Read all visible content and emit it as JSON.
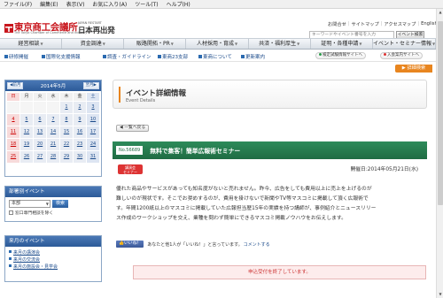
{
  "menubar": [
    "ファイル(F)",
    "編集(E)",
    "表示(V)",
    "お気に入り(A)",
    "ツール(T)",
    "ヘルプ(H)"
  ],
  "header": {
    "logo_main": "東京商工会議所",
    "logo_sub": "The Tokyo Chamber of Commerce and Industry",
    "jr_small": "JAPAN RESTART",
    "jr_main": "日本再出発",
    "links": [
      "お問合せ",
      "サイトマップ",
      "アクセスマップ",
      "English"
    ],
    "search_placeholder": "キーワードやイベント番号を入力",
    "search_button": "イベント検索"
  },
  "nav": [
    "経営相談",
    "資金調達",
    "販路開拓・PR",
    "人材採用・育成",
    "共済・福利厚生",
    "証明・各種申請",
    "イベント・セミナー情報"
  ],
  "subnav": {
    "items": [
      "研修開催",
      "国際化支援情報",
      "調査・ガイドライン",
      "東商23支部",
      "東商について",
      "更新案内"
    ],
    "pills": [
      "検定試験情報サイトへ",
      "入会案内サイトへ"
    ]
  },
  "detail_tab": "詳細検索",
  "calendar": {
    "prev": "◀前月",
    "title": "2014年5月",
    "next": "翌月▶",
    "dow": [
      "日",
      "月",
      "火",
      "水",
      "木",
      "金",
      "土"
    ],
    "cells": [
      "",
      "",
      "",
      "",
      "1",
      "2",
      "3",
      "4",
      "5",
      "6",
      "7",
      "8",
      "9",
      "10",
      "11",
      "12",
      "13",
      "14",
      "15",
      "16",
      "17",
      "18",
      "19",
      "20",
      "21",
      "22",
      "23",
      "24",
      "25",
      "26",
      "27",
      "28",
      "29",
      "30",
      "31"
    ]
  },
  "branch_panel": {
    "title": "部署別イベント",
    "select_value": "本部",
    "button": "検索",
    "checkbox_label": "窓口専門相談を除く"
  },
  "monthly_panel": {
    "title": "来月のイベント",
    "links": [
      "来月の講演会",
      "来月の交流会",
      "来月の施設会・見学会"
    ]
  },
  "page_title": {
    "ja": "イベント詳細情報",
    "en": "Event Details"
  },
  "back_button": "一覧へ戻る",
  "event": {
    "number": "No.56689",
    "title": "無料で集客！簡単広報術セミナー",
    "category": "講演会\nセミナー",
    "date": "開催日:2014年05月21日(水)",
    "body": [
      "優れた商品やサービスがあっても知名度がないと売れません。昨今、広告をしても費用以上に売上を上げるのが",
      "難しいのが現状です。そこでお奨めするのが、費用を掛けないで新聞やTV等マスコミに掲載して頂く広報術で",
      "す。年間1200紙以上のマスコミに掲載していた広報担当歴15年の実績を持つ講師が、事例紹介とニュースリリー",
      "ス作成のワークショップを交え、業種を問わず簡単にできるマスコミ掲載ノウハウをお伝えします。"
    ],
    "like_button": "いいね！",
    "like_text": "あなたと他1人が「いいね！」と言っています。",
    "comment_link": "コメントする",
    "closed": "申込受付を終了しています。"
  }
}
